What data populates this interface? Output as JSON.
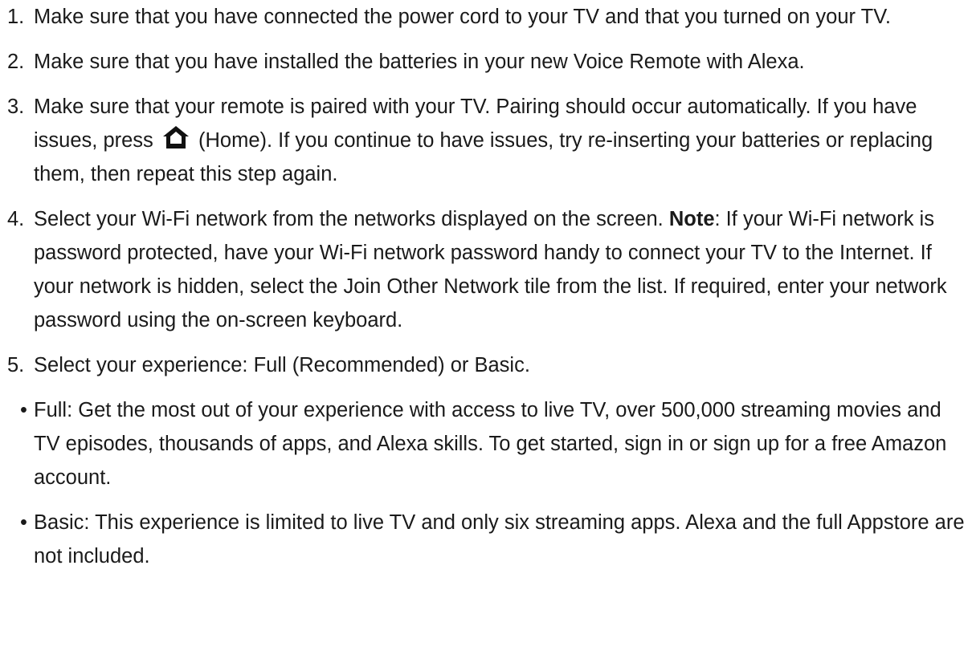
{
  "steps": [
    {
      "num": "1.",
      "text": "Make sure that you have connected the power cord to your TV and that you turned on your TV."
    },
    {
      "num": "2.",
      "text": "Make sure that you have installed the batteries in your new Voice Remote with Alexa."
    },
    {
      "num": "3.",
      "text_before": "Make sure that your remote is paired with your TV. Pairing should occur automatically. If you have issues, press",
      "text_after": "(Home). If you continue to have issues, try re-inserting your batteries or replacing them, then repeat this step again.",
      "icon": "home-icon"
    },
    {
      "num": "4.",
      "text_before": "Select your Wi-Fi network from the networks displayed on the screen.",
      "note_label": "Note",
      "text_after": ": If your Wi-Fi network is password protected, have your Wi-Fi network password handy to connect your TV to the Internet. If your network is hidden, select the Join Other Network tile from the list. If required, enter your network password using the on-screen keyboard."
    },
    {
      "num": "5.",
      "text": "Select your experience: Full (Recommended) or Basic."
    }
  ],
  "bullets": [
    {
      "dot": "•",
      "text": "Full: Get the most out of your experience with access to live TV, over 500,000 streaming movies and TV episodes, thousands of apps, and Alexa skills. To get started, sign in or sign up for a free Amazon account."
    },
    {
      "dot": "•",
      "text": "Basic: This experience is limited to live TV and only six streaming apps. Alexa and the full Appstore are not included."
    }
  ]
}
